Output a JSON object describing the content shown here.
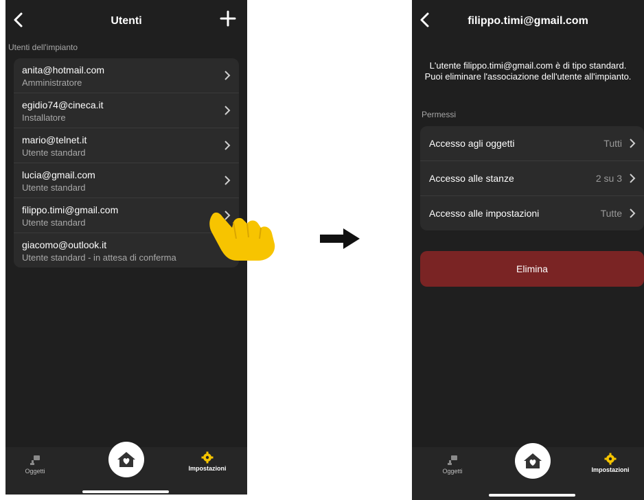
{
  "left": {
    "header": {
      "title": "Utenti"
    },
    "section_label": "Utenti dell'impianto",
    "users": [
      {
        "email": "anita@hotmail.com",
        "role": "Amministratore"
      },
      {
        "email": "egidio74@cineca.it",
        "role": "Installatore"
      },
      {
        "email": "mario@telnet.it",
        "role": "Utente standard"
      },
      {
        "email": "lucia@gmail.com",
        "role": "Utente standard"
      },
      {
        "email": "filippo.timi@gmail.com",
        "role": "Utente standard"
      },
      {
        "email": "giacomo@outlook.it",
        "role": "Utente standard - in attesa di conferma"
      }
    ],
    "tabs": {
      "objects": "Oggetti",
      "settings": "Impostazioni"
    }
  },
  "right": {
    "header": {
      "title": "filippo.timi@gmail.com"
    },
    "description_line1": "L'utente filippo.timi@gmail.com è di tipo standard.",
    "description_line2": "Puoi eliminare l'associazione dell'utente all'impianto.",
    "section_label": "Permessi",
    "permissions": [
      {
        "label": "Accesso agli oggetti",
        "value": "Tutti"
      },
      {
        "label": "Accesso alle stanze",
        "value": "2 su 3"
      },
      {
        "label": "Accesso alle impostazioni",
        "value": "Tutte"
      }
    ],
    "delete_label": "Elimina",
    "tabs": {
      "objects": "Oggetti",
      "settings": "Impostazioni"
    }
  },
  "colors": {
    "background": "#1f1f1f",
    "card": "#2b2b2b",
    "accent": "#f5c400",
    "danger": "#7a2424"
  }
}
